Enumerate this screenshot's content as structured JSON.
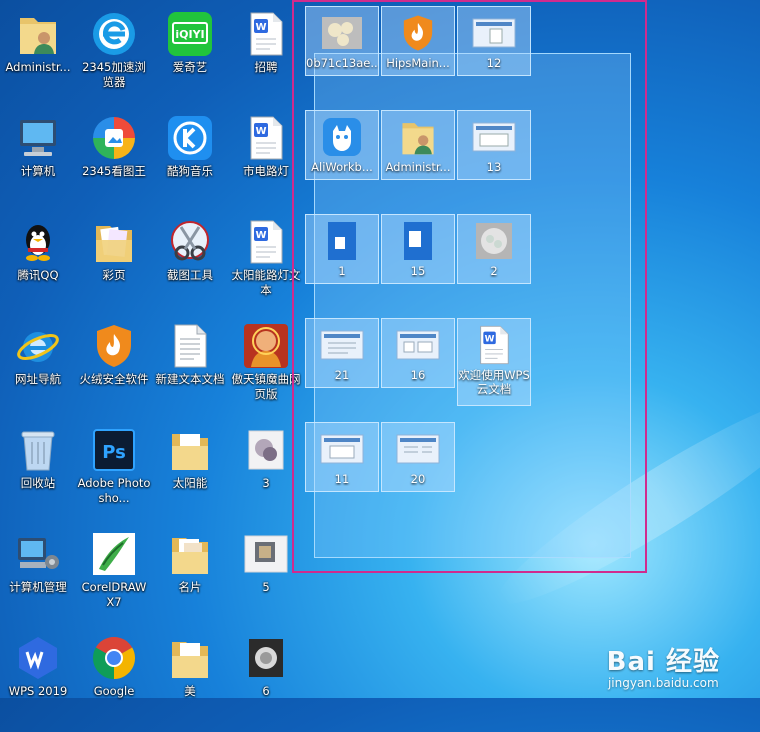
{
  "desktop": {
    "col1": [
      {
        "label": "Administr..."
      },
      {
        "label": "计算机"
      },
      {
        "label": "腾讯QQ"
      },
      {
        "label": "网址导航"
      },
      {
        "label": "回收站"
      },
      {
        "label": "计算机管理"
      },
      {
        "label": "WPS 2019"
      }
    ],
    "col2": [
      {
        "label": "2345加速浏览器"
      },
      {
        "label": "2345看图王"
      },
      {
        "label": "彩页"
      },
      {
        "label": "火绒安全软件"
      },
      {
        "label": "Adobe Photosho..."
      },
      {
        "label": "CorelDRAW X7"
      },
      {
        "label": "Google"
      }
    ],
    "col3": [
      {
        "label": "爱奇艺"
      },
      {
        "label": "酷狗音乐"
      },
      {
        "label": "截图工具"
      },
      {
        "label": "新建文本文档"
      },
      {
        "label": "太阳能"
      },
      {
        "label": "名片"
      },
      {
        "label": "美"
      }
    ],
    "col4": [
      {
        "label": "招聘"
      },
      {
        "label": "市电路灯"
      },
      {
        "label": "太阳能路灯文本"
      },
      {
        "label": "傲天镇魔曲网页版"
      },
      {
        "label": "3"
      },
      {
        "label": "5"
      },
      {
        "label": "6"
      }
    ]
  },
  "selection": {
    "items": [
      {
        "label": "0b71c13ae..."
      },
      {
        "label": "HipsMain..."
      },
      {
        "label": "12"
      },
      {
        "label": "AliWorkb..."
      },
      {
        "label": "Administr..."
      },
      {
        "label": "13"
      },
      {
        "label": "1"
      },
      {
        "label": "15"
      },
      {
        "label": "2"
      },
      {
        "label": "21"
      },
      {
        "label": "16"
      },
      {
        "label": "欢迎使用WPS云文档"
      },
      {
        "label": "11"
      },
      {
        "label": "20"
      }
    ]
  },
  "watermark": {
    "brand": "Bai 经验",
    "url": "jingyan.baidu.com"
  },
  "colors": {
    "highlight": "#d02b8e",
    "selection": "#8ccdff"
  }
}
